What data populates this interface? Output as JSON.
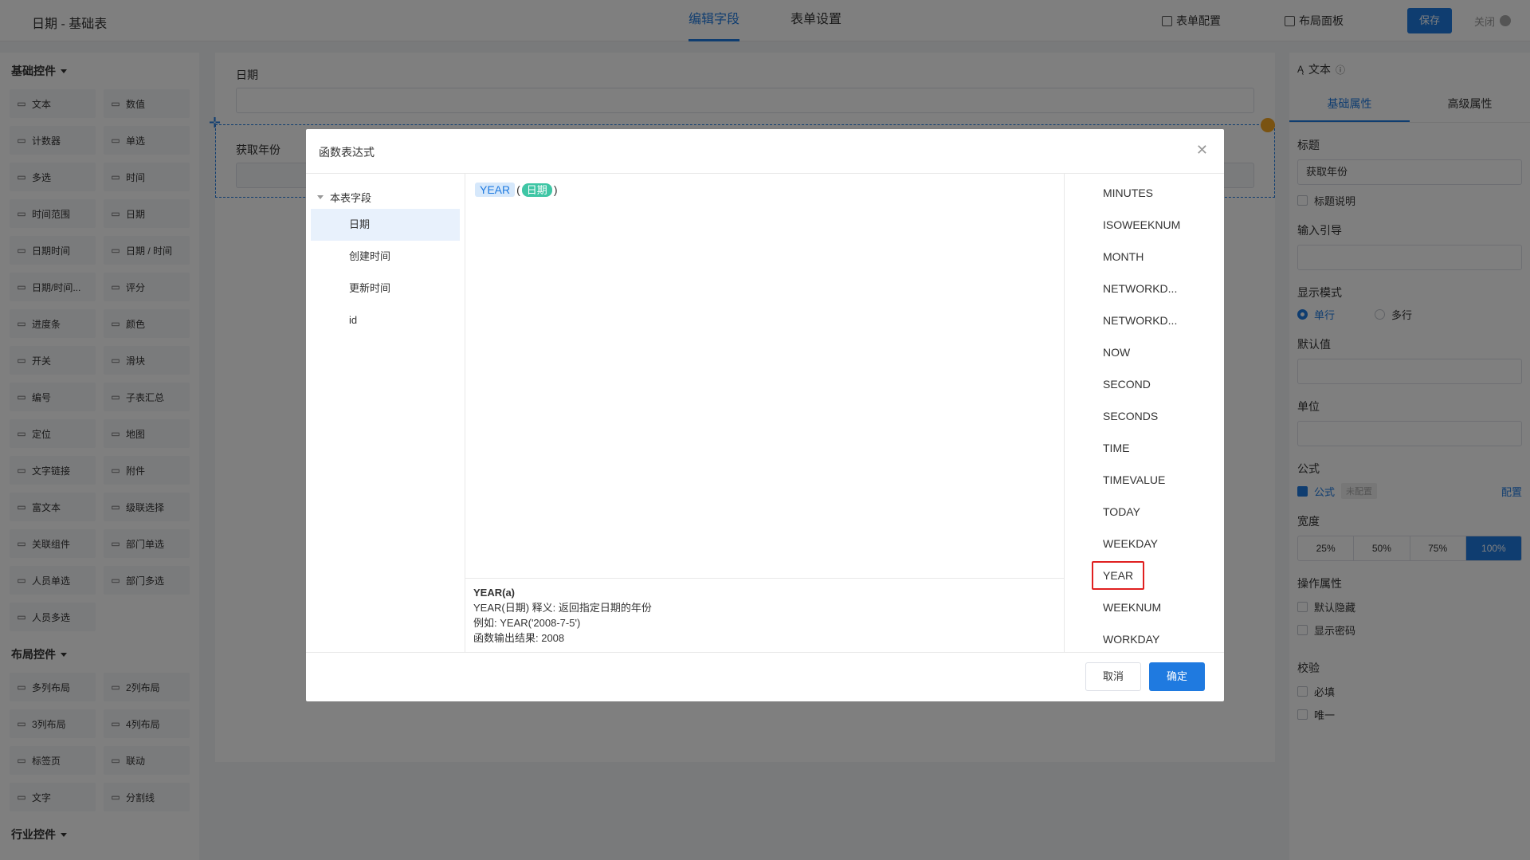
{
  "topbar": {
    "title": "日期 - 基础表",
    "tabs": [
      "编辑字段",
      "表单设置"
    ],
    "form_config": "表单配置",
    "layout_panel": "布局面板",
    "save": "保存",
    "close": "关闭"
  },
  "left": {
    "basic_title": "基础控件",
    "basic_items": [
      "文本",
      "数值",
      "计数器",
      "单选",
      "多选",
      "时间",
      "时间范围",
      "日期",
      "日期时间",
      "日期 / 时间",
      "日期/时间...",
      "评分",
      "进度条",
      "颜色",
      "开关",
      "滑块",
      "编号",
      "子表汇总",
      "定位",
      "地图",
      "文字链接",
      "附件",
      "富文本",
      "级联选择",
      "关联组件",
      "部门单选",
      "人员单选",
      "部门多选",
      "人员多选"
    ],
    "basic_icons": [
      "text-icon",
      "number-icon",
      "counter-icon",
      "radio-icon",
      "checkbox-icon",
      "clock-icon",
      "time-range-icon",
      "calendar-icon",
      "datetime-icon",
      "date-slash-time-icon",
      "datetime-range-icon",
      "star-icon",
      "progress-icon",
      "color-icon",
      "switch-icon",
      "slider-icon",
      "serial-icon",
      "sigma-icon",
      "location-icon",
      "map-icon",
      "text-link-icon",
      "attachment-icon",
      "rich-text-icon",
      "cascade-icon",
      "relation-icon",
      "dept-single-icon",
      "user-single-icon",
      "dept-multi-icon",
      "user-multi-icon"
    ],
    "layout_title": "布局控件",
    "layout_items": [
      "多列布局",
      "2列布局",
      "3列布局",
      "4列布局",
      "标签页",
      "联动",
      "文字",
      "分割线"
    ],
    "industry_title": "行业控件"
  },
  "canvas": {
    "field1_label": "日期",
    "field2_label": "获取年份"
  },
  "right": {
    "header": "文本",
    "tabs": [
      "基础属性",
      "高级属性"
    ],
    "title_label": "标题",
    "title_value": "获取年份",
    "title_desc": "标题说明",
    "input_guide": "输入引导",
    "display_mode": "显示模式",
    "single_line": "单行",
    "multi_line": "多行",
    "default_value": "默认值",
    "unit": "单位",
    "formula": "公式",
    "formula_check": "公式",
    "formula_tag": "未配置",
    "configure": "配置",
    "width": "宽度",
    "widths": [
      "25%",
      "50%",
      "75%",
      "100%"
    ],
    "operation": "操作属性",
    "default_hidden": "默认隐藏",
    "show_password": "显示密码",
    "validation": "校验",
    "required": "必填",
    "unique": "唯一"
  },
  "dialog": {
    "title": "函数表达式",
    "tree_root": "本表字段",
    "fields": [
      "日期",
      "创建时间",
      "更新时间",
      "id"
    ],
    "expression": {
      "func": "YEAR",
      "open": "(",
      "arg": "日期",
      "close": ")"
    },
    "desc": {
      "signature": "YEAR(a)",
      "meaning": "YEAR(日期) 释义: 返回指定日期的年份",
      "example": "例如: YEAR('2008-7-5')",
      "result": "函数输出结果: 2008"
    },
    "functions": [
      "MINUTES",
      "ISOWEEKNUM",
      "MONTH",
      "NETWORKD...",
      "NETWORKD...",
      "NOW",
      "SECOND",
      "SECONDS",
      "TIME",
      "TIMEVALUE",
      "TODAY",
      "WEEKDAY",
      "YEAR",
      "WEEKNUM",
      "WORKDAY"
    ],
    "cancel": "取消",
    "ok": "确定"
  }
}
